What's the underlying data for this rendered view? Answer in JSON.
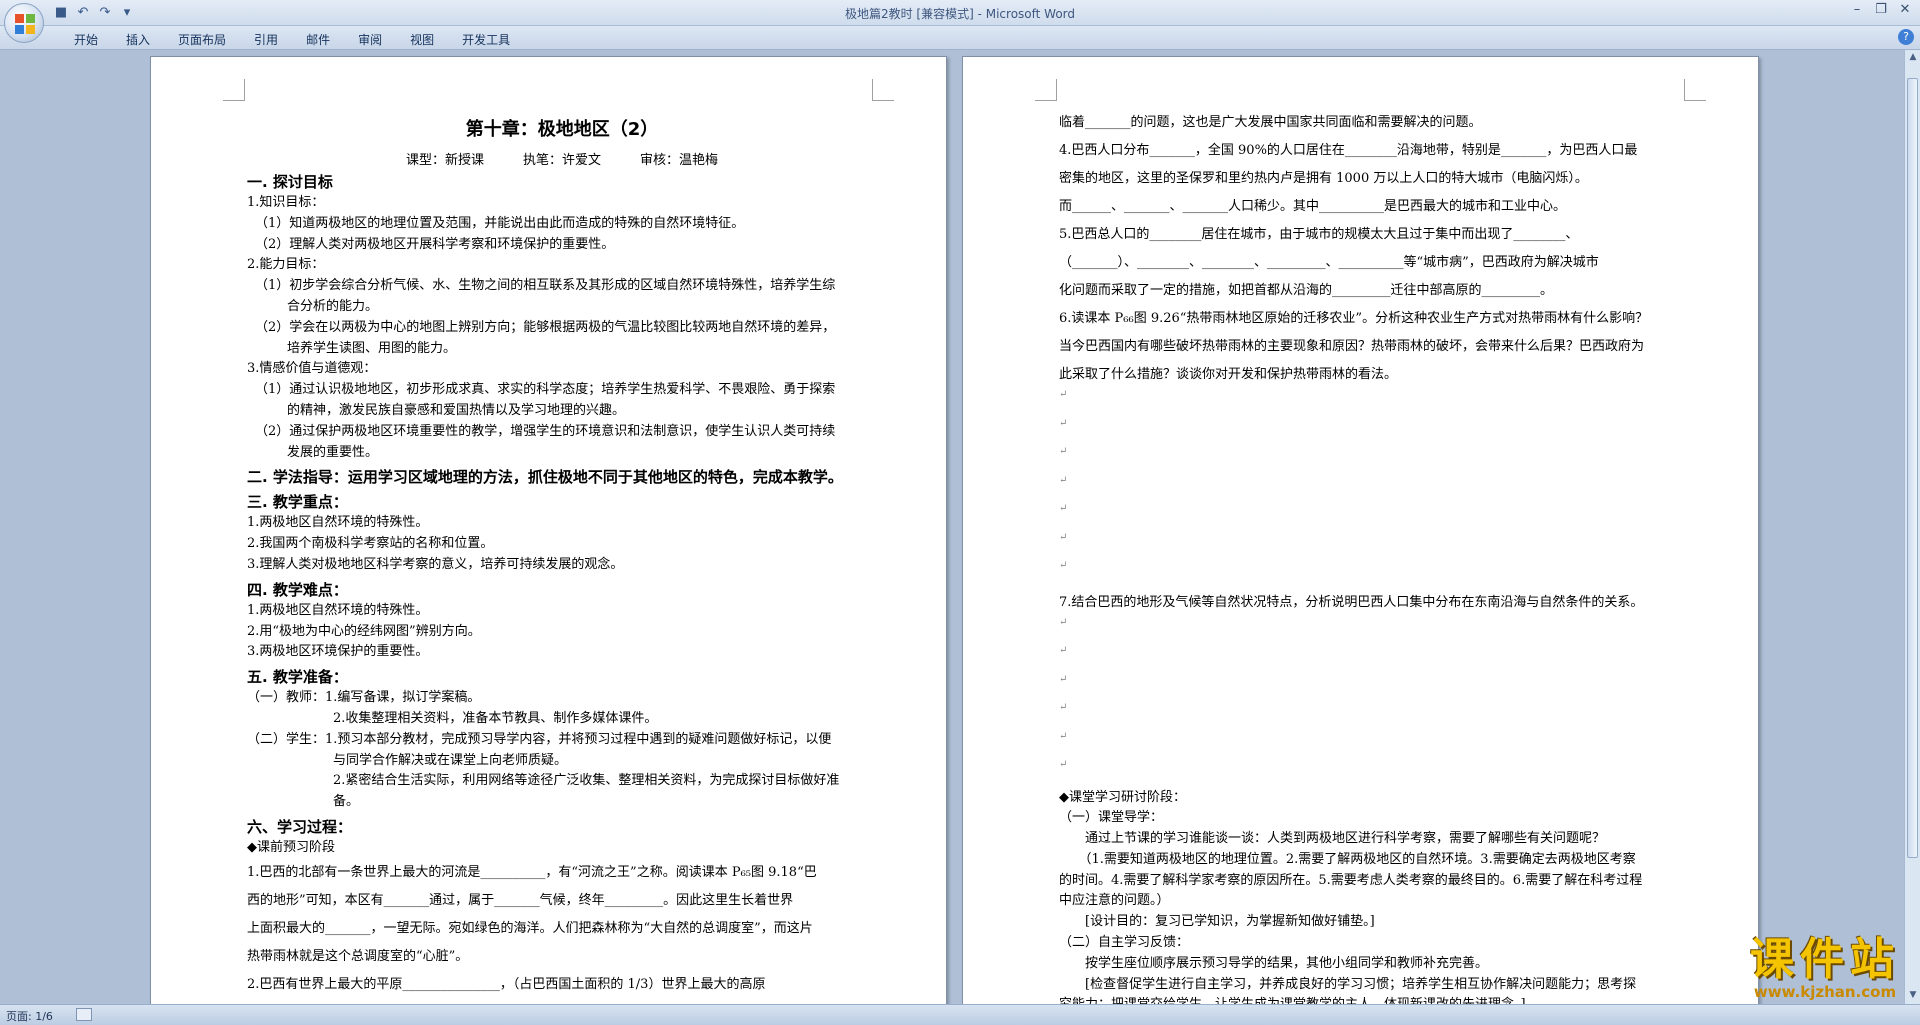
{
  "window": {
    "title": "极地篇2教时 [兼容模式] - Microsoft Word"
  },
  "ribbon": {
    "tabs": [
      "开始",
      "插入",
      "页面布局",
      "引用",
      "邮件",
      "审阅",
      "视图",
      "开发工具"
    ]
  },
  "status": {
    "page": "页面: 1/6"
  },
  "watermark": {
    "title": "课件站",
    "url": "www.kjzhan.com"
  },
  "left_page": {
    "title": "第十章：极地地区（2）",
    "subline": "课型：新授课　　　执笔：许爱文　　　审核：温艳梅",
    "lines": [
      {
        "t": "一. 探讨目标",
        "c": "sec"
      },
      {
        "t": "1.知识目标：",
        "c": "ln"
      },
      {
        "t": "（1）知道两极地区的地理位置及范围，并能说出由此而造成的特殊的自然环境特征。",
        "c": "ln ind1"
      },
      {
        "t": "（2）理解人类对两极地区开展科学考察和环境保护的重要性。",
        "c": "ln ind1"
      },
      {
        "t": "2.能力目标：",
        "c": "ln"
      },
      {
        "t": "（1）初步学会综合分析气候、水、生物之间的相互联系及其形成的区域自然环境特殊性，培养学生综",
        "c": "ln ind1"
      },
      {
        "t": "合分析的能力。",
        "c": "ln ind2"
      },
      {
        "t": "（2）学会在以两极为中心的地图上辨别方向；能够根据两极的气温比较图比较两地自然环境的差异，",
        "c": "ln ind1"
      },
      {
        "t": "培养学生读图、用图的能力。",
        "c": "ln ind2"
      },
      {
        "t": "3.情感价值与道德观：",
        "c": "ln"
      },
      {
        "t": "（1）通过认识极地地区，初步形成求真、求实的科学态度；培养学生热爱科学、不畏艰险、勇于探索",
        "c": "ln ind1"
      },
      {
        "t": "的精神，激发民族自豪感和爱国热情以及学习地理的兴趣。",
        "c": "ln ind2"
      },
      {
        "t": "（2）通过保护两极地区环境重要性的教学，增强学生的环境意识和法制意识，使学生认识人类可持续",
        "c": "ln ind1"
      },
      {
        "t": "发展的重要性。",
        "c": "ln ind2"
      },
      {
        "t": "二. 学法指导：运用学习区域地理的方法，抓住极地不同于其他地区的特色，完成本教学。",
        "c": "sec"
      },
      {
        "t": "三. 教学重点：",
        "c": "sec"
      },
      {
        "t": "1.两极地区自然环境的特殊性。",
        "c": "ln"
      },
      {
        "t": "2.我国两个南极科学考察站的名称和位置。",
        "c": "ln"
      },
      {
        "t": "3.理解人类对极地地区科学考察的意义，培养可持续发展的观念。",
        "c": "ln"
      },
      {
        "t": "四. 教学难点：",
        "c": "sec"
      },
      {
        "t": "1.两极地区自然环境的特殊性。",
        "c": "ln"
      },
      {
        "t": "2.用“极地为中心的经纬网图”辨别方向。",
        "c": "ln"
      },
      {
        "t": "3.两极地区环境保护的重要性。",
        "c": "ln"
      },
      {
        "t": "五. 教学准备：",
        "c": "sec"
      },
      {
        "t": "（一）教师：1.编写备课，拟订学案稿。",
        "c": "ln"
      },
      {
        "t": "2.收集整理相关资料，准备本节教具、制作多媒体课件。",
        "c": "ln ind3"
      },
      {
        "t": "（二）学生：1.预习本部分教材，完成预习导学内容，并将预习过程中遇到的疑难问题做好标记，以便",
        "c": "ln"
      },
      {
        "t": "与同学合作解决或在课堂上向老师质疑。",
        "c": "ln ind3"
      },
      {
        "t": "2.紧密结合生活实际，利用网络等途径广泛收集、整理相关资料，为完成探讨目标做好准",
        "c": "ln ind3"
      },
      {
        "t": "备。",
        "c": "ln ind3"
      },
      {
        "t": "六、学习过程：",
        "c": "sec"
      },
      {
        "t": "◆课前预习阶段",
        "c": "ln"
      },
      {
        "t": "1.巴西的北部有一条世界上最大的河流是__________，有“河流之王”之称。阅读课本 P₆₅图 9.18“巴",
        "c": "ln tall"
      },
      {
        "t": "西的地形”可知，本区有_______通过，属于_______气候，终年_________。因此这里生长着世界",
        "c": "ln tall"
      },
      {
        "t": "上面积最大的_______，一望无际。宛如绿色的海洋。人们把森林称为“大自然的总调度室”，而这片",
        "c": "ln tall"
      },
      {
        "t": "热带雨林就是这个总调度室的“心脏”。",
        "c": "ln tall"
      },
      {
        "t": "2.巴西有世界上最大的平原_______________，（占巴西国土面积的 1/3）世界上最大的高原",
        "c": "ln tall"
      }
    ]
  },
  "right_page": {
    "lines": [
      {
        "t": "临着_______的问题，这也是广大发展中国家共同面临和需要解决的问题。",
        "c": "ln tall"
      },
      {
        "t": "4.巴西人口分布_______，全国 90%的人口居住在________沿海地带，特别是_______，为巴西人口最",
        "c": "ln tall"
      },
      {
        "t": "密集的地区，这里的圣保罗和里约热内卢是拥有 1000 万以上人口的特大城市（电脑闪烁）。",
        "c": "ln tall"
      },
      {
        "t": "而______、_______、_______人口稀少。其中__________是巴西最大的城市和工业中心。",
        "c": "ln tall"
      },
      {
        "t": "5.巴西总人口的________居住在城市，由于城市的规模太大且过于集中而出现了________、",
        "c": "ln tall"
      },
      {
        "t": "（_______）、________、________、_________、__________等“城市病”，巴西政府为解决城市",
        "c": "ln tall"
      },
      {
        "t": "化问题而采取了一定的措施，如把首都从沿海的_________迁往中部高原的_________。",
        "c": "ln tall"
      },
      {
        "t": "6.读课本 P₆₆图 9.26“热带雨林地区原始的迁移农业”。分析这种农业生产方式对热带雨林有什么影响？",
        "c": "ln tall"
      },
      {
        "t": "当今巴西国内有哪些破坏热带雨林的主要现象和原因？热带雨林的破坏，会带来什么后果？巴西政府为",
        "c": "ln tall"
      },
      {
        "t": "此采取了什么措施？谈谈你对开发和保护热带雨林的看法。",
        "c": "ln tall"
      },
      {
        "t": "",
        "c": "empty"
      },
      {
        "t": "",
        "c": "empty"
      },
      {
        "t": "",
        "c": "empty"
      },
      {
        "t": "",
        "c": "empty"
      },
      {
        "t": "",
        "c": "empty"
      },
      {
        "t": "",
        "c": "empty"
      },
      {
        "t": "",
        "c": "empty"
      },
      {
        "t": "7.结合巴西的地形及气候等自然状况特点，分析说明巴西人口集中分布在东南沿海与自然条件的关系。",
        "c": "ln tall"
      },
      {
        "t": "",
        "c": "empty"
      },
      {
        "t": "",
        "c": "empty"
      },
      {
        "t": "",
        "c": "empty"
      },
      {
        "t": "",
        "c": "empty"
      },
      {
        "t": "",
        "c": "empty"
      },
      {
        "t": "",
        "c": "empty"
      },
      {
        "t": "◆课堂学习研讨阶段：",
        "c": "ln"
      },
      {
        "t": "（一）课堂导学：",
        "c": "ln"
      },
      {
        "t": "　　通过上节课的学习谁能谈一谈：人类到两极地区进行科学考察，需要了解哪些有关问题呢？",
        "c": "ln"
      },
      {
        "t": "　　（1.需要知道两极地区的地理位置。2.需要了解两极地区的自然环境。3.需要确定去两极地区考察",
        "c": "ln"
      },
      {
        "t": "的时间。4.需要了解科学家考察的原因所在。5.需要考虑人类考察的最终目的。6.需要了解在科考过程",
        "c": "ln"
      },
      {
        "t": "中应注意的问题。）",
        "c": "ln"
      },
      {
        "t": "　　[设计目的：复习已学知识，为掌握新知做好铺垫。]",
        "c": "ln"
      },
      {
        "t": "（二）自主学习反馈：",
        "c": "ln"
      },
      {
        "t": "　　按学生座位顺序展示预习导学的结果，其他小组同学和教师补充完善。",
        "c": "ln"
      },
      {
        "t": "　　[检查督促学生进行自主学习，并养成良好的学习习惯；培养学生相互协作解决问题能力；思考探",
        "c": "ln"
      },
      {
        "t": "究能力；把课堂交给学生，让学生成为课堂教学的主人，体现新课改的先进理念。]",
        "c": "ln"
      }
    ]
  }
}
